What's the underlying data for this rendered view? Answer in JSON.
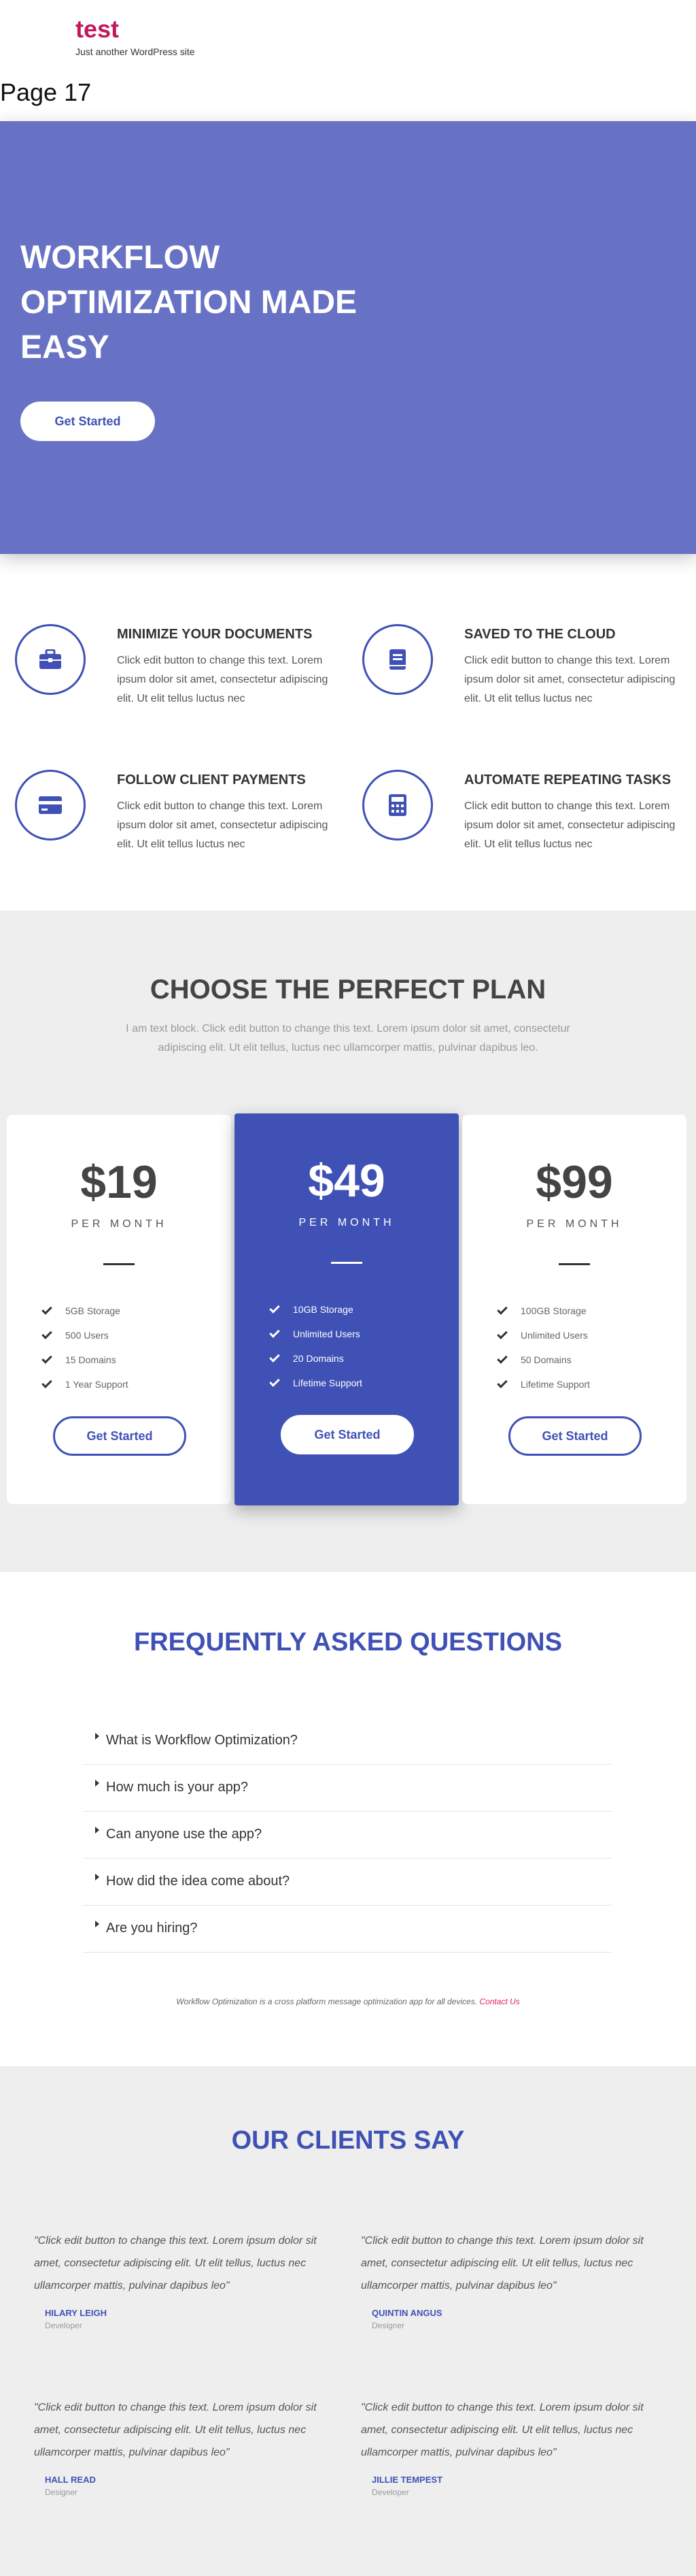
{
  "site": {
    "title": "test",
    "tagline": "Just another WordPress site",
    "page_title": "Page 17"
  },
  "hero": {
    "title": "WORKFLOW OPTIMIZATION MADE EASY",
    "button": "Get Started",
    "bg": "#6872c4"
  },
  "features": [
    {
      "title": "MINIMIZE YOUR DOCUMENTS",
      "text": "Click edit button to change this text. Lorem ipsum dolor sit amet, consectetur adipiscing elit. Ut elit tellus luctus nec",
      "icon": "briefcase-icon"
    },
    {
      "title": "SAVED TO THE CLOUD",
      "text": "Click edit button to change this text. Lorem ipsum dolor sit amet, consectetur adipiscing elit. Ut elit tellus luctus nec",
      "icon": "book-icon"
    },
    {
      "title": "FOLLOW CLIENT PAYMENTS",
      "text": "Click edit button to change this text. Lorem ipsum dolor sit amet, consectetur adipiscing elit. Ut elit tellus luctus nec",
      "icon": "credit-card-icon"
    },
    {
      "title": "AUTOMATE REPEATING TASKS",
      "text": "Click edit button to change this text. Lorem ipsum dolor sit amet, consectetur adipiscing elit. Ut elit tellus luctus nec",
      "icon": "calculator-icon"
    }
  ],
  "pricing": {
    "title": "CHOOSE THE PERFECT PLAN",
    "subtitle": "I am text block. Click edit button to change this text. Lorem ipsum dolor sit amet, consectetur adipiscing elit. Ut elit tellus, luctus nec ullamcorper mattis, pulvinar dapibus leo.",
    "plans": [
      {
        "price": "$19",
        "period": "PER MONTH",
        "features": [
          "5GB Storage",
          "500 Users",
          "15 Domains",
          "1 Year Support"
        ],
        "button": "Get Started"
      },
      {
        "price": "$49",
        "period": "PER MONTH",
        "features": [
          "10GB Storage",
          "Unlimited Users",
          "20 Domains",
          "Lifetime Support"
        ],
        "button": "Get Started"
      },
      {
        "price": "$99",
        "period": "PER MONTH",
        "features": [
          "100GB Storage",
          "Unlimited Users",
          "50 Domains",
          "Lifetime Support"
        ],
        "button": "Get Started"
      }
    ]
  },
  "faq": {
    "title": "FREQUENTLY ASKED QUESTIONS",
    "questions": [
      "What is Workflow Optimization?",
      "How much is your app?",
      "Can anyone use the app?",
      "How did the idea come about?",
      "Are you hiring?"
    ],
    "note": "Workflow Optimization is a cross platform message optimization app for all devices.",
    "note_link": "Contact Us"
  },
  "clients": {
    "title": "OUR CLIENTS SAY",
    "testimonials": [
      {
        "quote": "\"Click edit button to change this text. Lorem ipsum dolor sit amet, consectetur adipiscing elit. Ut elit tellus, luctus nec ullamcorper mattis, pulvinar dapibus leo\"",
        "name": "HILARY LEIGH",
        "role": "Developer"
      },
      {
        "quote": "\"Click edit button to change this text. Lorem ipsum dolor sit amet, consectetur adipiscing elit. Ut elit tellus, luctus nec ullamcorper mattis, pulvinar dapibus leo\"",
        "name": "QUINTIN ANGUS",
        "role": "Designer"
      },
      {
        "quote": "\"Click edit button to change this text. Lorem ipsum dolor sit amet, consectetur adipiscing elit. Ut elit tellus, luctus nec ullamcorper mattis, pulvinar dapibus leo\"",
        "name": "HALL READ",
        "role": "Designer"
      },
      {
        "quote": "\"Click edit button to change this text. Lorem ipsum dolor sit amet, consectetur adipiscing elit. Ut elit tellus, luctus nec ullamcorper mattis, pulvinar dapibus leo\"",
        "name": "JILLIE TEMPEST",
        "role": "Developer"
      }
    ]
  },
  "colors": {
    "accent": "#3f51b5",
    "brand": "#c2185b",
    "link": "#e91e63",
    "section_bg": "#eeeeee"
  }
}
